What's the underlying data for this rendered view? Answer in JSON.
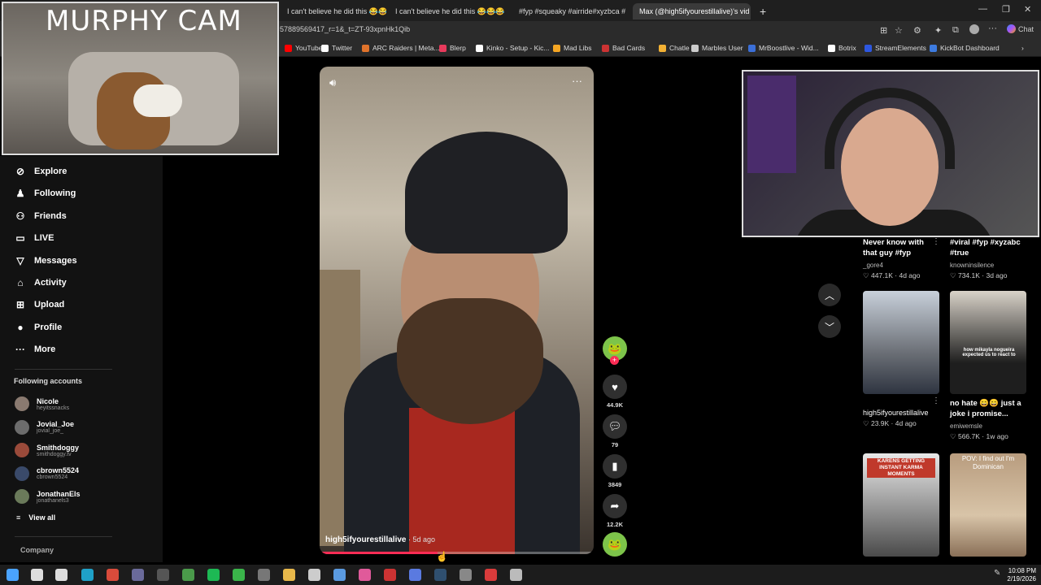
{
  "browser": {
    "tabs": [
      {
        "label": "I can't believe he did this 😂😂😂",
        "close": "✕"
      },
      {
        "label": "I can't believe he did this 😂😂😂",
        "close": "✕"
      },
      {
        "label": "#fyp #squeaky #airride#xyzbca #",
        "close": "✕"
      },
      {
        "label": "Max (@high5ifyourestillalive)'s vid",
        "close": "✕"
      }
    ],
    "new_tab": "+",
    "url": "57889569417_r=1&_t=ZT-93xpnHk1Qib",
    "chat_label": "Chat",
    "bookmarks": [
      {
        "label": "YouTube",
        "color": "#ff0000"
      },
      {
        "label": "Twitter",
        "color": "#ffffff"
      },
      {
        "label": "ARC Raiders | Meta...",
        "color": "#e0732b"
      },
      {
        "label": "Blerp",
        "color": "#e83a5c"
      },
      {
        "label": "Kinko - Setup - Kic...",
        "color": "#ffffff"
      },
      {
        "label": "Mad Libs",
        "color": "#f5a623"
      },
      {
        "label": "Bad Cards",
        "color": "#cc3333"
      },
      {
        "label": "Chatle",
        "color": "#f2b134"
      },
      {
        "label": "Marbles User",
        "color": "#cccccc"
      },
      {
        "label": "MrBoostlive - Wid...",
        "color": "#3b6fd8"
      },
      {
        "label": "Botrix",
        "color": "#ffffff"
      },
      {
        "label": "StreamElements",
        "color": "#2d57e0"
      },
      {
        "label": "KickBot Dashboard",
        "color": "#3d7be0"
      }
    ]
  },
  "overlay": {
    "murphy_title": "MURPHY CAM"
  },
  "sidebar": {
    "items": [
      {
        "label": "Explore",
        "icon": "⊘"
      },
      {
        "label": "Following",
        "icon": "♟"
      },
      {
        "label": "Friends",
        "icon": "⚇"
      },
      {
        "label": "LIVE",
        "icon": "▭"
      },
      {
        "label": "Messages",
        "icon": "▽"
      },
      {
        "label": "Activity",
        "icon": "⌂"
      },
      {
        "label": "Upload",
        "icon": "⊞"
      },
      {
        "label": "Profile",
        "icon": "●"
      },
      {
        "label": "More",
        "icon": "···"
      }
    ],
    "following_header": "Following accounts",
    "accounts": [
      {
        "name": "Nicole",
        "handle": "heyitssnacks"
      },
      {
        "name": "Jovial_Joe",
        "handle": "jovial_joe_"
      },
      {
        "name": "Smithdoggy",
        "handle": "smithdoggy.tv"
      },
      {
        "name": "cbrown5524",
        "handle": "cbrown5524"
      },
      {
        "name": "JonathanEls",
        "handle": "jonathanels3"
      }
    ],
    "view_all": "View all",
    "company": "Company"
  },
  "video": {
    "author": "high5ifyourestillalive",
    "age": " · 5d ago",
    "progress": 0.43,
    "accent": "#fe2c55"
  },
  "actions": {
    "likes": "44.9K",
    "comments": "79",
    "saves": "3849",
    "shares": "12.2K"
  },
  "grid": [
    {
      "title": "Never know with that guy #fyp",
      "user": "_gore4",
      "meta": "♡ 447.1K · 4d ago"
    },
    {
      "title": "#viral #fyp #xyzabc #true",
      "user": "knowninsilence",
      "meta": "♡ 734.1K · 3d ago"
    },
    {
      "title": "",
      "user": "high5ifyourestillalive",
      "meta": "♡ 23.9K · 4d ago",
      "caption": "",
      "label2": "high5ifyourestillalive"
    },
    {
      "title": "no hate 😄😄 just a joke i promise...",
      "user": "emiwemsle",
      "meta": "♡ 566.7K · 1w ago",
      "caption": "how mikayla nogueira expected us to react to"
    },
    {
      "title": "",
      "user": "",
      "meta": "",
      "caption": "KARENS GETTING INSTANT KARMA MOMENTS"
    },
    {
      "title": "",
      "user": "",
      "meta": "",
      "caption": "POV: I find out I'm Dominican"
    }
  ],
  "taskbar": {
    "time": "10:08 PM",
    "date": "2/19/2026"
  }
}
